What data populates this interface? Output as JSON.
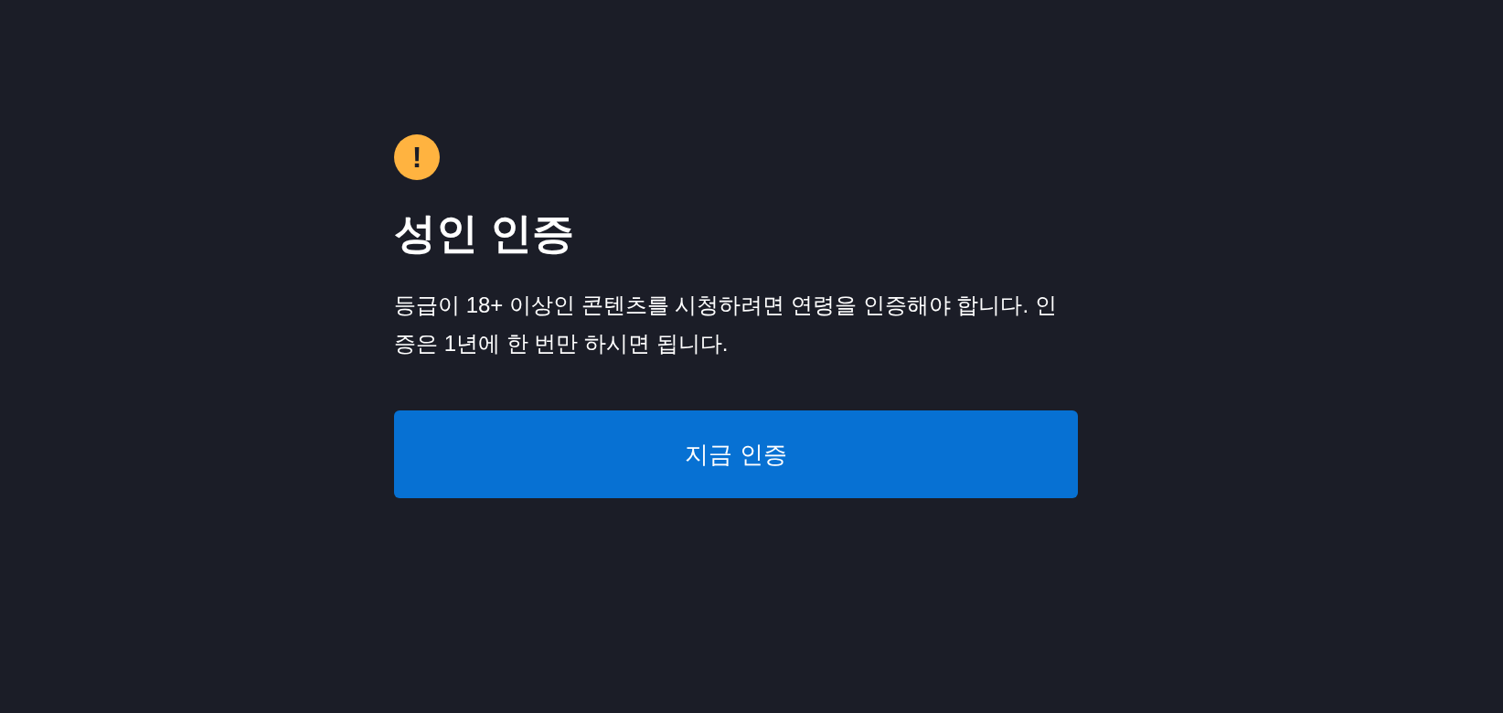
{
  "alert": {
    "title": "성인 인증",
    "message": "등급이 18+ 이상인 콘텐츠를 시청하려면 연령을 인증해야 합니다. 인증은 1년에 한 번만 하시면 됩니다.",
    "icon_glyph": "!",
    "button": "지금 인증"
  }
}
